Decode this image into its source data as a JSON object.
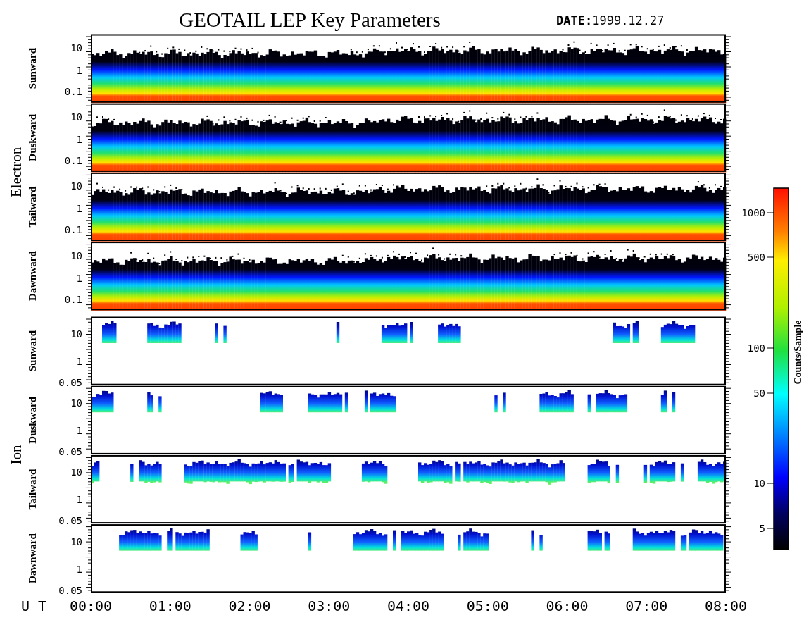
{
  "title": "GEOTAIL LEP Key Parameters",
  "date": "**DATE:**1999.12.27",
  "groups": [
    {
      "kind": "electron",
      "label": "Electron",
      "panels": [
        {
          "label": "Sunward",
          "yticks": [
            "10",
            "1",
            "0.1"
          ]
        },
        {
          "label": "Duskward",
          "yticks": [
            "10",
            "1",
            "0.1"
          ]
        },
        {
          "label": "Tailward",
          "yticks": [
            "10",
            "1",
            "0.1"
          ]
        },
        {
          "label": "Dawnward",
          "yticks": [
            "10",
            "1",
            "0.1"
          ]
        }
      ]
    },
    {
      "kind": "ion",
      "label": "Ion",
      "panels": [
        {
          "label": "Sunward",
          "yticks": [
            "10",
            "1",
            "0.05"
          ]
        },
        {
          "label": "Duskward",
          "yticks": [
            "10",
            "1",
            "0.05"
          ]
        },
        {
          "label": "Tailward",
          "yticks": [
            "10",
            "1",
            "0.05"
          ]
        },
        {
          "label": "Dawnward",
          "yticks": [
            "10",
            "1",
            "0.05"
          ]
        }
      ]
    }
  ],
  "colorbar": {
    "label": "Counts/Sample",
    "ticks": [
      "1000",
      "500",
      "100",
      "50",
      "10",
      "5"
    ]
  },
  "time_axis": {
    "label": "U T",
    "ticks": [
      "00:00",
      "01:00",
      "02:00",
      "03:00",
      "04:00",
      "05:00",
      "06:00",
      "07:00",
      "08:00"
    ]
  }
}
